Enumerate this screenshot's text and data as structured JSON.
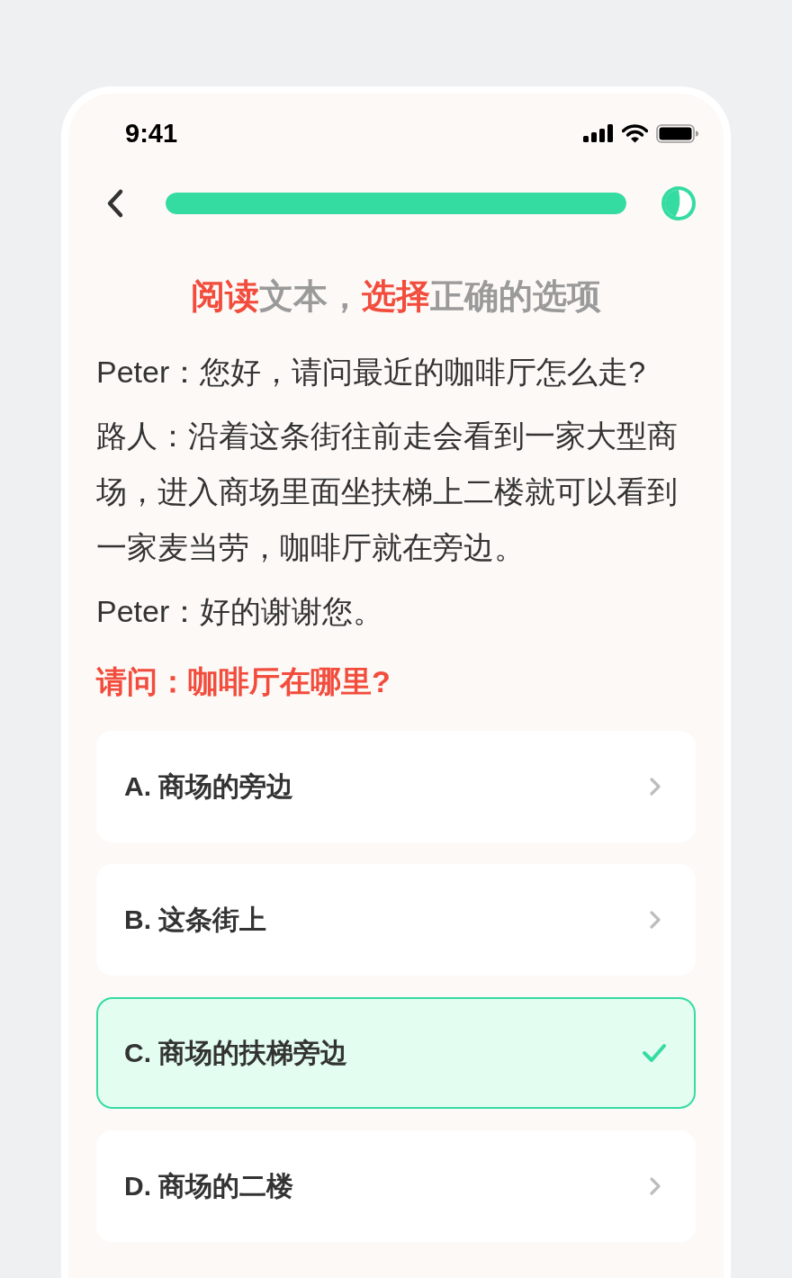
{
  "status_bar": {
    "time": "9:41"
  },
  "nav": {
    "progress": {
      "level": 1
    }
  },
  "title": [
    {
      "text": "阅读",
      "highlight": true
    },
    {
      "text": "文本，",
      "highlight": false
    },
    {
      "text": "选择",
      "highlight": true
    },
    {
      "text": "正确的选项",
      "highlight": false
    }
  ],
  "dialogue": [
    "Peter：您好，请问最近的咖啡厅怎么走?",
    "路人：沿着这条街往前走会看到一家大型商场，进入商场里面坐扶梯上二楼就可以看到一家麦当劳，咖啡厅就在旁边。",
    "Peter：好的谢谢您。"
  ],
  "question": "请问：咖啡厅在哪里?",
  "options": [
    {
      "label": "A. 商场的旁边",
      "selected": false
    },
    {
      "label": "B. 这条街上",
      "selected": false
    },
    {
      "label": "C. 商场的扶梯旁边",
      "selected": true
    },
    {
      "label": "D. 商场的二楼",
      "selected": false
    }
  ]
}
